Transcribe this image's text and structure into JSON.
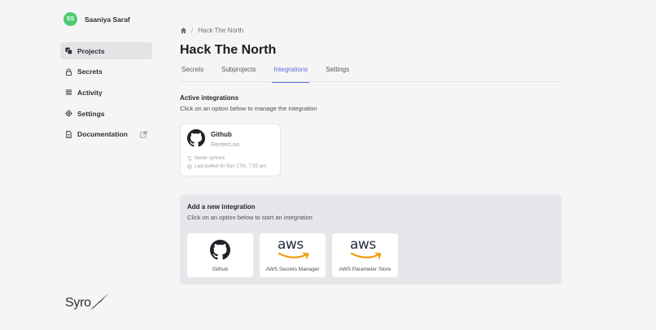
{
  "user": {
    "initials": "SS",
    "name": "Saaniya Saraf",
    "avatar_color": "#4ecb71"
  },
  "sidebar": {
    "items": [
      {
        "label": "Projects",
        "icon": "projects-icon",
        "active": true
      },
      {
        "label": "Secrets",
        "icon": "lock-icon"
      },
      {
        "label": "Activity",
        "icon": "list-icon"
      },
      {
        "label": "Settings",
        "icon": "gear-icon"
      },
      {
        "label": "Documentation",
        "icon": "document-icon",
        "external": "external-link-icon"
      }
    ]
  },
  "logo": {
    "text": "Syro"
  },
  "breadcrumb": {
    "home_icon": "home-icon",
    "separator": "/",
    "current": "Hack The North"
  },
  "page_title": "Hack The North",
  "tabs": [
    {
      "label": "Secrets"
    },
    {
      "label": "Subprojects"
    },
    {
      "label": "Integrations",
      "active": true
    },
    {
      "label": "Settings"
    }
  ],
  "accent_color": "#5b6fd9",
  "active_integrations": {
    "title": "Active integrations",
    "subtitle": "Click on an option below to manage the integration",
    "cards": [
      {
        "name": "Github",
        "repo": "RenterLoo",
        "sync_status": "Never synced",
        "last_pulled": "Last pulled on Sun 17th, 7:33 am"
      }
    ]
  },
  "add_integration": {
    "title": "Add a new integration",
    "subtitle": "Click on an option below to start an integration",
    "options": [
      {
        "label": "Github",
        "logo": "github-icon"
      },
      {
        "label": "AWS Secrets Manager",
        "logo_text": "aws"
      },
      {
        "label": "AWS Parameter Store",
        "logo_text": "aws"
      }
    ]
  }
}
